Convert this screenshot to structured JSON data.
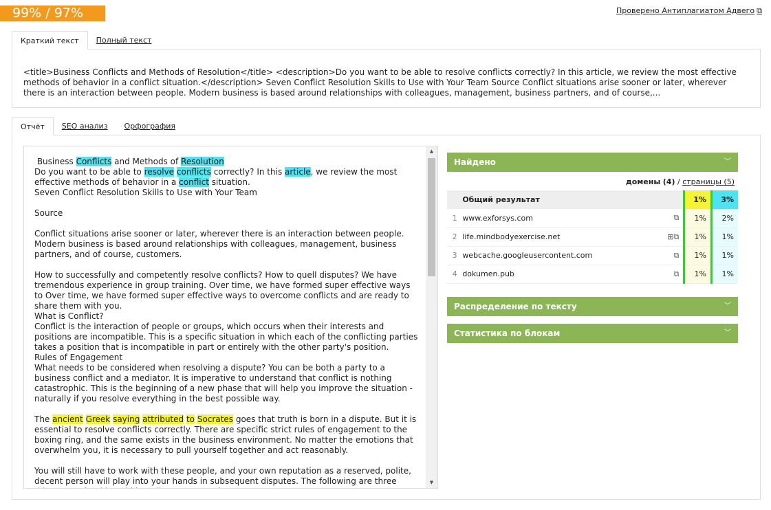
{
  "score": "99% / 97%",
  "checked_link": "Проверено Антиплагиатом Адвего",
  "top_tabs": [
    "Краткий текст",
    "Полный текст"
  ],
  "summary_text": "<title>Business Conflicts and Methods of Resolution</title> <description>Do you want to be able to resolve conflicts correctly? In this article, we review the most effective methods of behavior in a conflict situation.</description> Seven Conflict Resolution Skills to Use with Your Team Source Conflict situations arise sooner or later, wherever there is an interaction between people. Modern business is based around relationships with colleagues, management, business partners, and of course,...",
  "report_tabs": [
    "Отчёт",
    "SEO анализ",
    "Орфография"
  ],
  "text": {
    "l1": [
      "Business ",
      "Conflicts",
      " and Methods of ",
      "Resolution"
    ],
    "l2": [
      " Do you want to be able to ",
      "resolve",
      " ",
      "conflicts",
      " correctly? In this ",
      "article",
      ", we review the most effective methods of behavior in a ",
      "conflict",
      " situation."
    ],
    "l3": "Seven Conflict Resolution Skills to Use with Your Team",
    "l4": "Source",
    "p1": "Conflict situations arise sooner or later, wherever there is an interaction between people. Modern business is based around relationships with colleagues, management, business partners, and of course, customers.",
    "p2": "How to successfully and competently resolve conflicts? How to quell disputes? We have tremendous experience in group training. Over time, we have formed super effective ways to Over time, we have formed super effective ways to overcome conflicts and are ready to share them with you.",
    "h1": "What is Conflict?",
    "p3": "Conflict is the interaction of people or groups, which occurs when their interests and positions are incompatible. This is a specific situation in which each of the conflicting parties takes a position that is incompatible in part or entirely with the other party's position.",
    "h2": "Rules of Engagement",
    "p4": "What needs to be considered when resolving a dispute? You can be both a party to a business conflict and a mediator. It is imperative to understand that conflict is nothing catastrophic. This is the beginning of a new phase that will help you improve the situation - naturally if you resolve everything in the best possible way.",
    "p5": [
      "The ",
      "ancient",
      " ",
      "Greek",
      " ",
      "saying",
      " ",
      "attributed",
      " ",
      "to",
      " ",
      "Socrates",
      " goes that truth is born in a dispute. But it is essential to resolve conflicts correctly. There are specific strict rules of engagement to the boxing ring, and the same exists in the business environment. No matter the emotions that overwhelm you, it is necessary to pull yourself together and act reasonably."
    ],
    "p6": "You will still have to work with these people, and your own reputation as a reserved, polite, decent person will play into your hands in subsequent disputes. The following are three things you should avoid in a dispute at any time."
  },
  "found": {
    "title": "Найдено",
    "domains_label": "домены",
    "domains_count": "(4)",
    "sep": "/",
    "pages_link": "страницы (5)",
    "total_label": "Общий результат",
    "total_p1": "1%",
    "total_p2": "3%",
    "rows": [
      {
        "n": "1",
        "domain": "www.exforsys.com",
        "p1": "1%",
        "p2": "2%"
      },
      {
        "n": "2",
        "domain": "life.mindbodyexercise.net",
        "p1": "1%",
        "p2": "1%"
      },
      {
        "n": "3",
        "domain": "webcache.googleusercontent.com",
        "p1": "1%",
        "p2": "1%"
      },
      {
        "n": "4",
        "domain": "dokumen.pub",
        "p1": "1%",
        "p2": "1%"
      }
    ]
  },
  "panels": {
    "distribution": "Распределение по тексту",
    "blocks": "Статистика по блокам"
  },
  "colors": {
    "orange": "#f39a1e",
    "green": "#8cb656",
    "yellow": "#f6f336",
    "cyan": "#4ee3f0"
  }
}
